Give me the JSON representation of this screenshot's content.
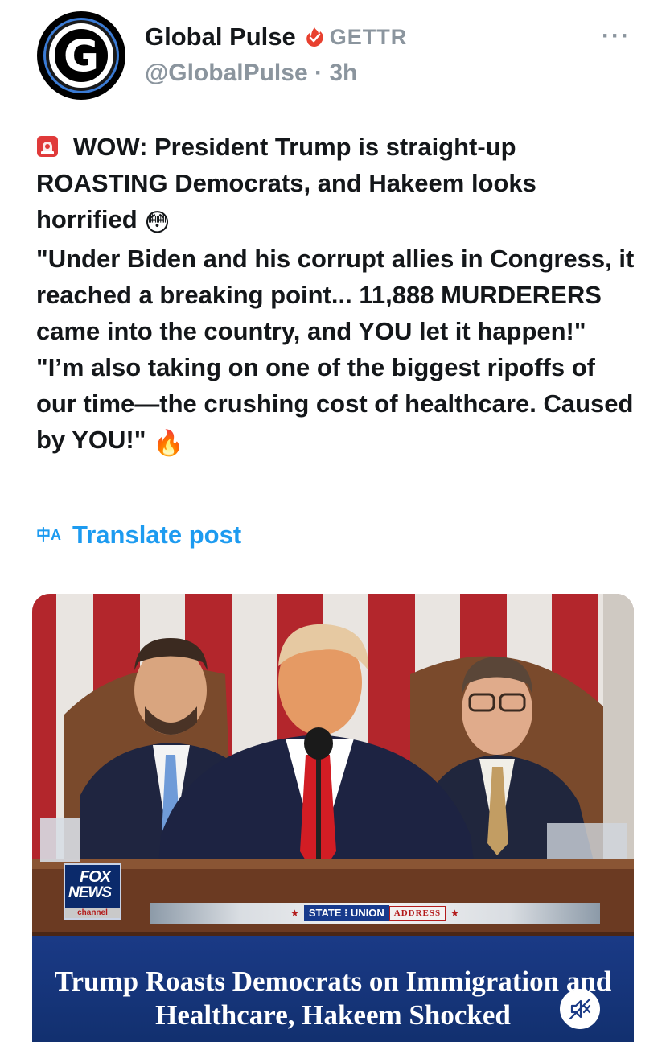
{
  "author": {
    "display_name": "Global Pulse",
    "platform": "GETTR",
    "handle": "@GlobalPulse",
    "separator": "·",
    "timestamp": "3h",
    "avatar_letter": "G"
  },
  "more_menu_label": "···",
  "post": {
    "lines": [
      "WOW: President Trump is straight-up ROASTING Democrats, and Hakeem looks horrified",
      "\"Under Biden and his corrupt allies in Congress, it reached a breaking point... 11,888 MURDERERS came into the country, and YOU let it happen!\"",
      "\"I’m also taking on one of the biggest ripoffs of our time—the crushing cost of healthcare. Caused by YOU!\""
    ],
    "emoji_flushed": "😳",
    "emoji_fire": "🔥"
  },
  "translate": {
    "icon_label": "中A",
    "label": "Translate post"
  },
  "media": {
    "caption_line1": "Trump Roasts Democrats on Immigration and",
    "caption_line2": "Healthcare, Hakeem Shocked",
    "network_logo": [
      "FOX",
      "NEWS",
      "channel"
    ],
    "banner_title": "STATE OF THE UNION",
    "banner_title_short": "STATE ⁝ UNION",
    "banner_sub": "ADDRESS",
    "mute_icon": "muted-speaker-icon"
  },
  "colors": {
    "accent_blue": "#1d9bf0",
    "verified_red": "#e8402f",
    "secondary_gray": "#8b959e",
    "caption_bg": "#1a3a86"
  }
}
